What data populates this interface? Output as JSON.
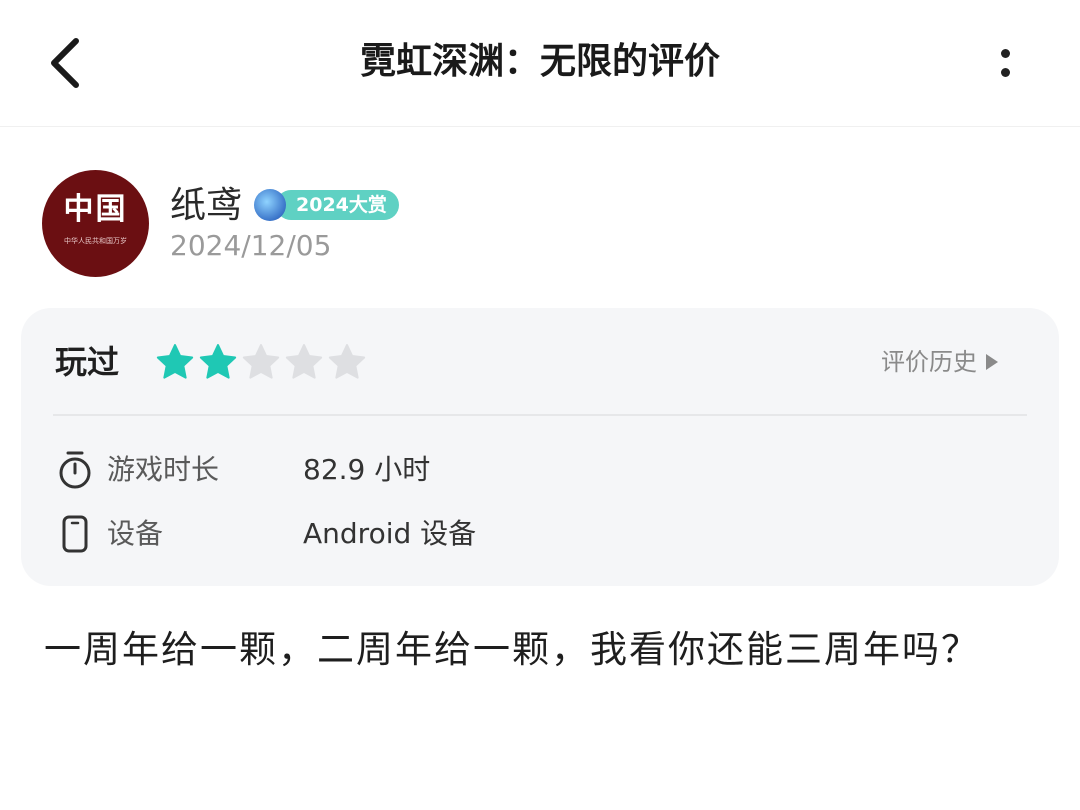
{
  "header": {
    "title": "霓虹深渊：无限的评价"
  },
  "user": {
    "avatar_text": "中国",
    "avatar_subtext": "中华人民共和国万岁",
    "name": "纸鸢",
    "badge_label": "2024大赏",
    "date": "2024/12/05"
  },
  "rating_card": {
    "played_label": "玩过",
    "rating": 2,
    "max_rating": 5,
    "history_label": "评价历史",
    "playtime_label": "游戏时长",
    "playtime_value": "82.9 小时",
    "device_label": "设备",
    "device_value": "Android 设备"
  },
  "review": {
    "text": "一周年给一颗，二周年给一颗，我看你还能三周年吗？"
  },
  "colors": {
    "star_filled": "#1fc8b4",
    "star_empty": "#dedfe2",
    "badge": "#5fd1c3",
    "avatar_bg": "#6b0f12"
  },
  "icons": {
    "back": "chevron-left-icon",
    "more": "more-vertical-icon",
    "history": "play-triangle-icon",
    "playtime": "stopwatch-icon",
    "device": "phone-icon"
  }
}
